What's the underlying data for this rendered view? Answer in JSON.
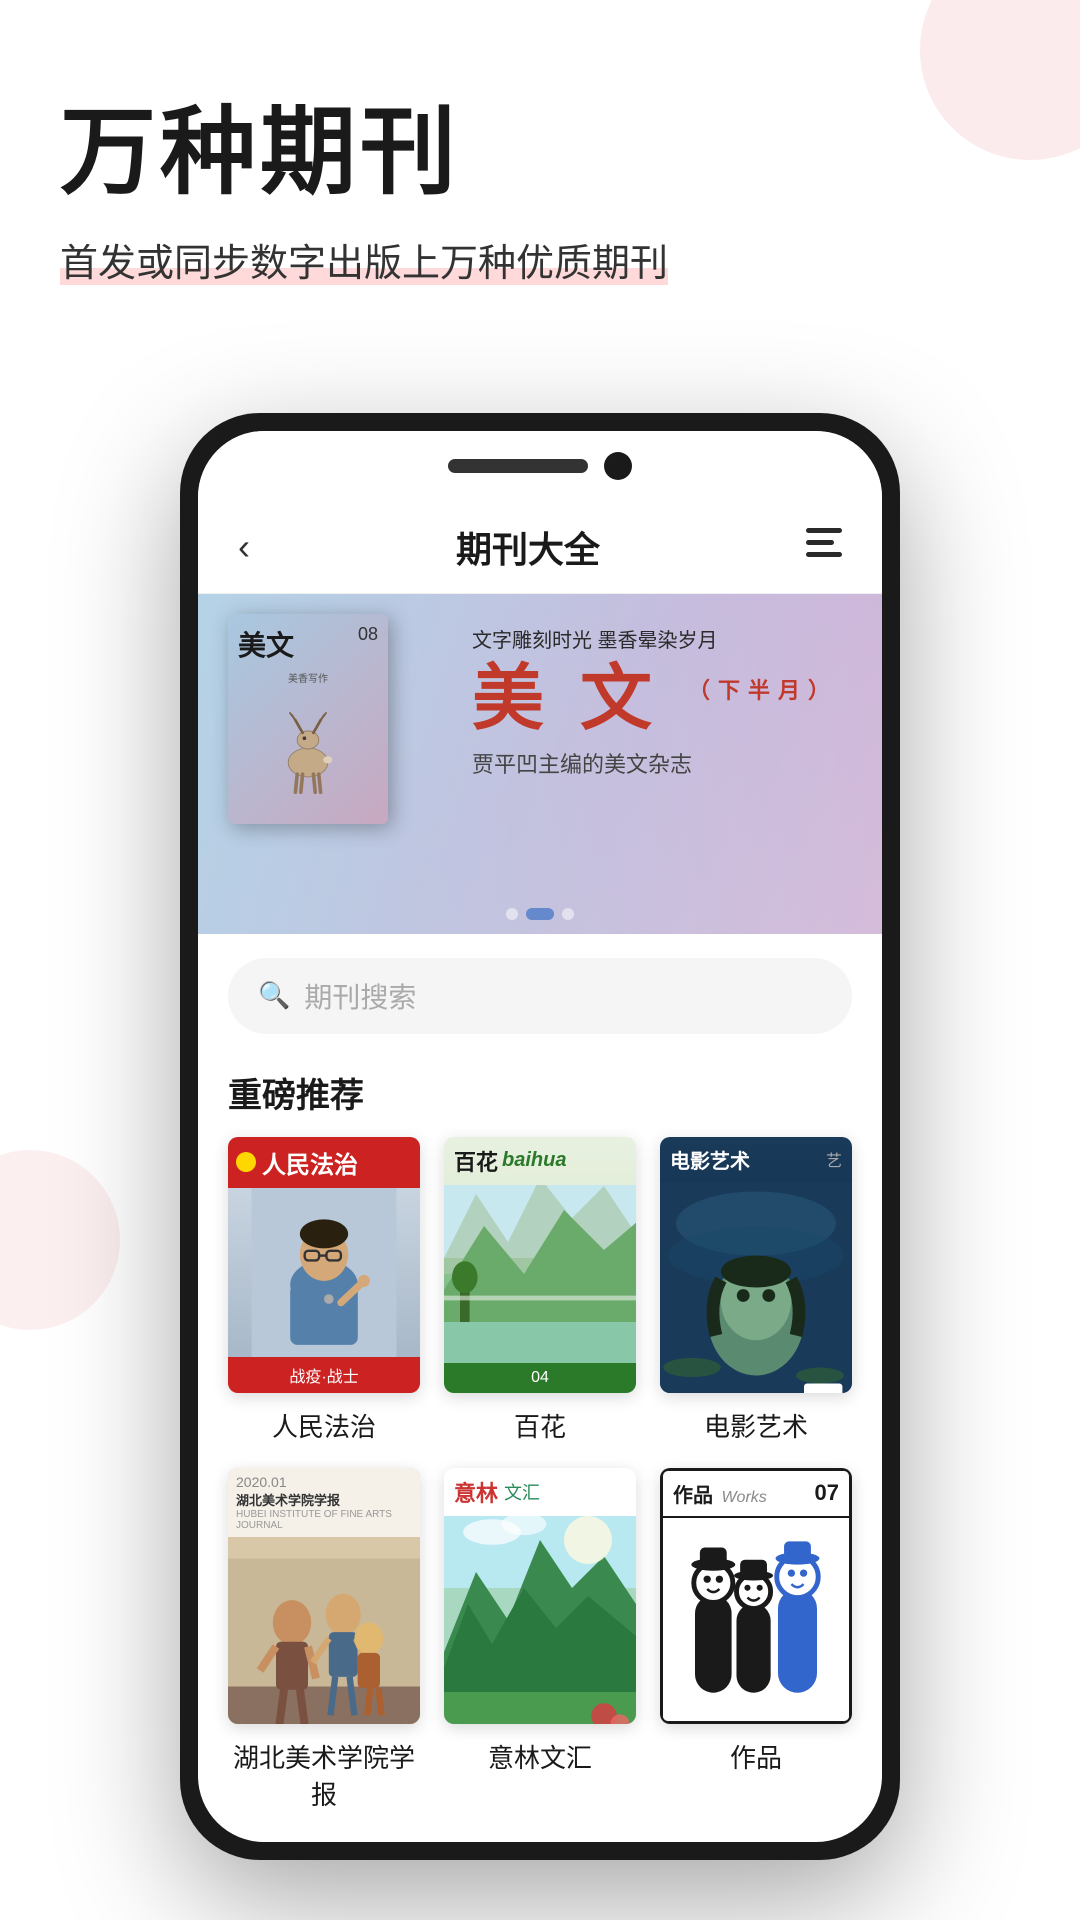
{
  "hero": {
    "title": "万种期刊",
    "subtitle": "首发或同步数字出版上万种优质期刊"
  },
  "app": {
    "header": {
      "back_label": "‹",
      "title": "期刊大全",
      "menu_label": "☰"
    },
    "banner": {
      "slogan_top": "文字雕刻时光  墨香晕染岁月",
      "main_title": "美 文",
      "half_moon": "（下半月）",
      "subtitle": "贾平凹主编的美文杂志",
      "mag_title": "美文",
      "mag_issue": "08"
    },
    "search": {
      "placeholder": "期刊搜索"
    },
    "section_title": "重磅推荐",
    "magazines": [
      {
        "id": "renmin",
        "name": "人民法治",
        "type": "renmin"
      },
      {
        "id": "baihua",
        "name": "百花",
        "type": "baihua"
      },
      {
        "id": "dianying",
        "name": "电影艺术",
        "type": "dianying"
      },
      {
        "id": "hubei",
        "name": "湖北美术学院学报",
        "type": "hubei"
      },
      {
        "id": "yilin",
        "name": "意林文汇",
        "type": "yilin"
      },
      {
        "id": "zuopin",
        "name": "作品",
        "type": "zuopin"
      }
    ],
    "banner_dots": 3
  },
  "colors": {
    "accent": "#c0392b",
    "green": "#2a7a2a",
    "navy": "#1a3a5a",
    "pink_bg": "#f8d7da"
  }
}
